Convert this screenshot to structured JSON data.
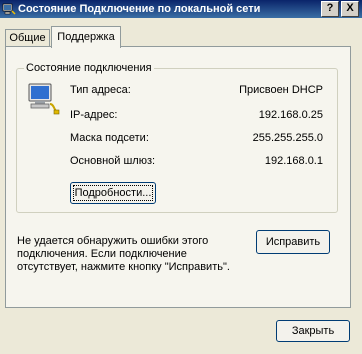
{
  "window": {
    "title": "Состояние Подключение по локальной сети",
    "help_button": "?",
    "close_button": "X"
  },
  "tabs": [
    {
      "label": "Общие",
      "selected": false
    },
    {
      "label": "Поддержка",
      "selected": true
    }
  ],
  "status_group": {
    "title": "Состояние подключения",
    "icon": "network-computer-icon",
    "rows": [
      {
        "label": "Тип адреса:",
        "value": "Присвоен DHCP"
      },
      {
        "label": "IP-адрес:",
        "value": "192.168.0.25"
      },
      {
        "label": "Маска подсети:",
        "value": "255.255.255.0"
      },
      {
        "label": "Основной шлюз:",
        "value": "192.168.0.1"
      }
    ],
    "details_button": "Подробности..."
  },
  "repair": {
    "message": "Не удается обнаружить ошибки этого подключения. Если подключение отсутствует, нажмите кнопку \"Исправить\".",
    "button": "Исправить"
  },
  "footer": {
    "close_button": "Закрыть"
  }
}
